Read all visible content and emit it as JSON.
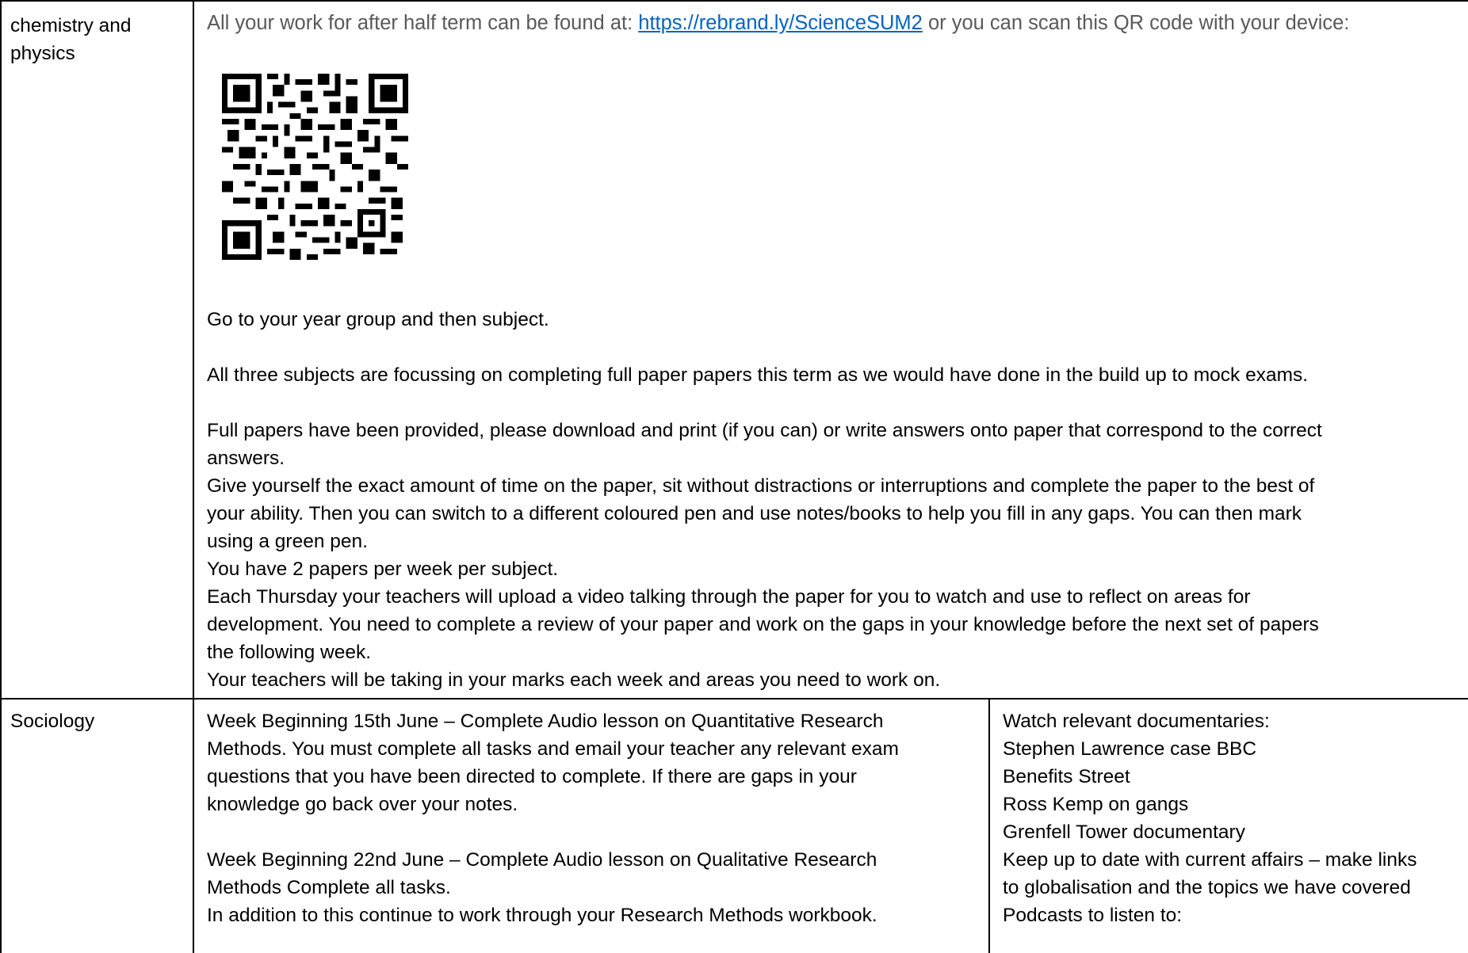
{
  "row1": {
    "subject_line1": "chemistry and",
    "subject_line2": "physics",
    "intro_before": "All your work for after half term can be found at: ",
    "intro_link": "https://rebrand.ly/ScienceSUM2",
    "intro_after": " or you can scan this QR code with your device:",
    "qr_icon": "qr-code-icon",
    "lines": [
      "Go to your year group and then subject.",
      "All three subjects are focussing on completing full paper papers this term as we would have done in the build up to mock exams.",
      "Full papers have been provided, please download and print (if you can) or write answers onto paper that correspond to the correct",
      "answers.",
      "Give yourself the exact amount of time on the paper, sit without distractions or interruptions and complete the paper to the best of",
      "your ability. Then you can switch to a different coloured pen and use notes/books to help you fill in any gaps. You can then mark",
      "using a green pen.",
      "You have 2 papers per week per subject.",
      "Each Thursday your teachers will upload a video talking through the paper for you to watch and use to reflect on areas for",
      "development. You need to complete a review of your paper and work on the gaps in your knowledge before the next set of papers",
      "the following week.",
      "Your teachers will be taking in your marks each week and areas you need to work on."
    ]
  },
  "row2": {
    "subject": "Sociology",
    "middle_lines": [
      "Week Beginning 15th June – Complete Audio lesson on Quantitative Research",
      "Methods. You must complete all tasks and email your teacher any relevant exam",
      "questions that you have been directed to complete. If there are gaps in your",
      "knowledge go back over your notes.",
      "Week Beginning  22nd June – Complete Audio lesson on Qualitative Research",
      "Methods  Complete all tasks.",
      "In addition to this continue to work through your Research Methods workbook."
    ],
    "right_lines": [
      "Watch relevant documentaries:",
      "Stephen Lawrence case BBC",
      "Benefits Street",
      "Ross Kemp on gangs",
      "Grenfell Tower documentary",
      "Keep up to date with current affairs – make links",
      "to globalisation and the topics we have covered",
      "Podcasts to listen to:"
    ]
  }
}
